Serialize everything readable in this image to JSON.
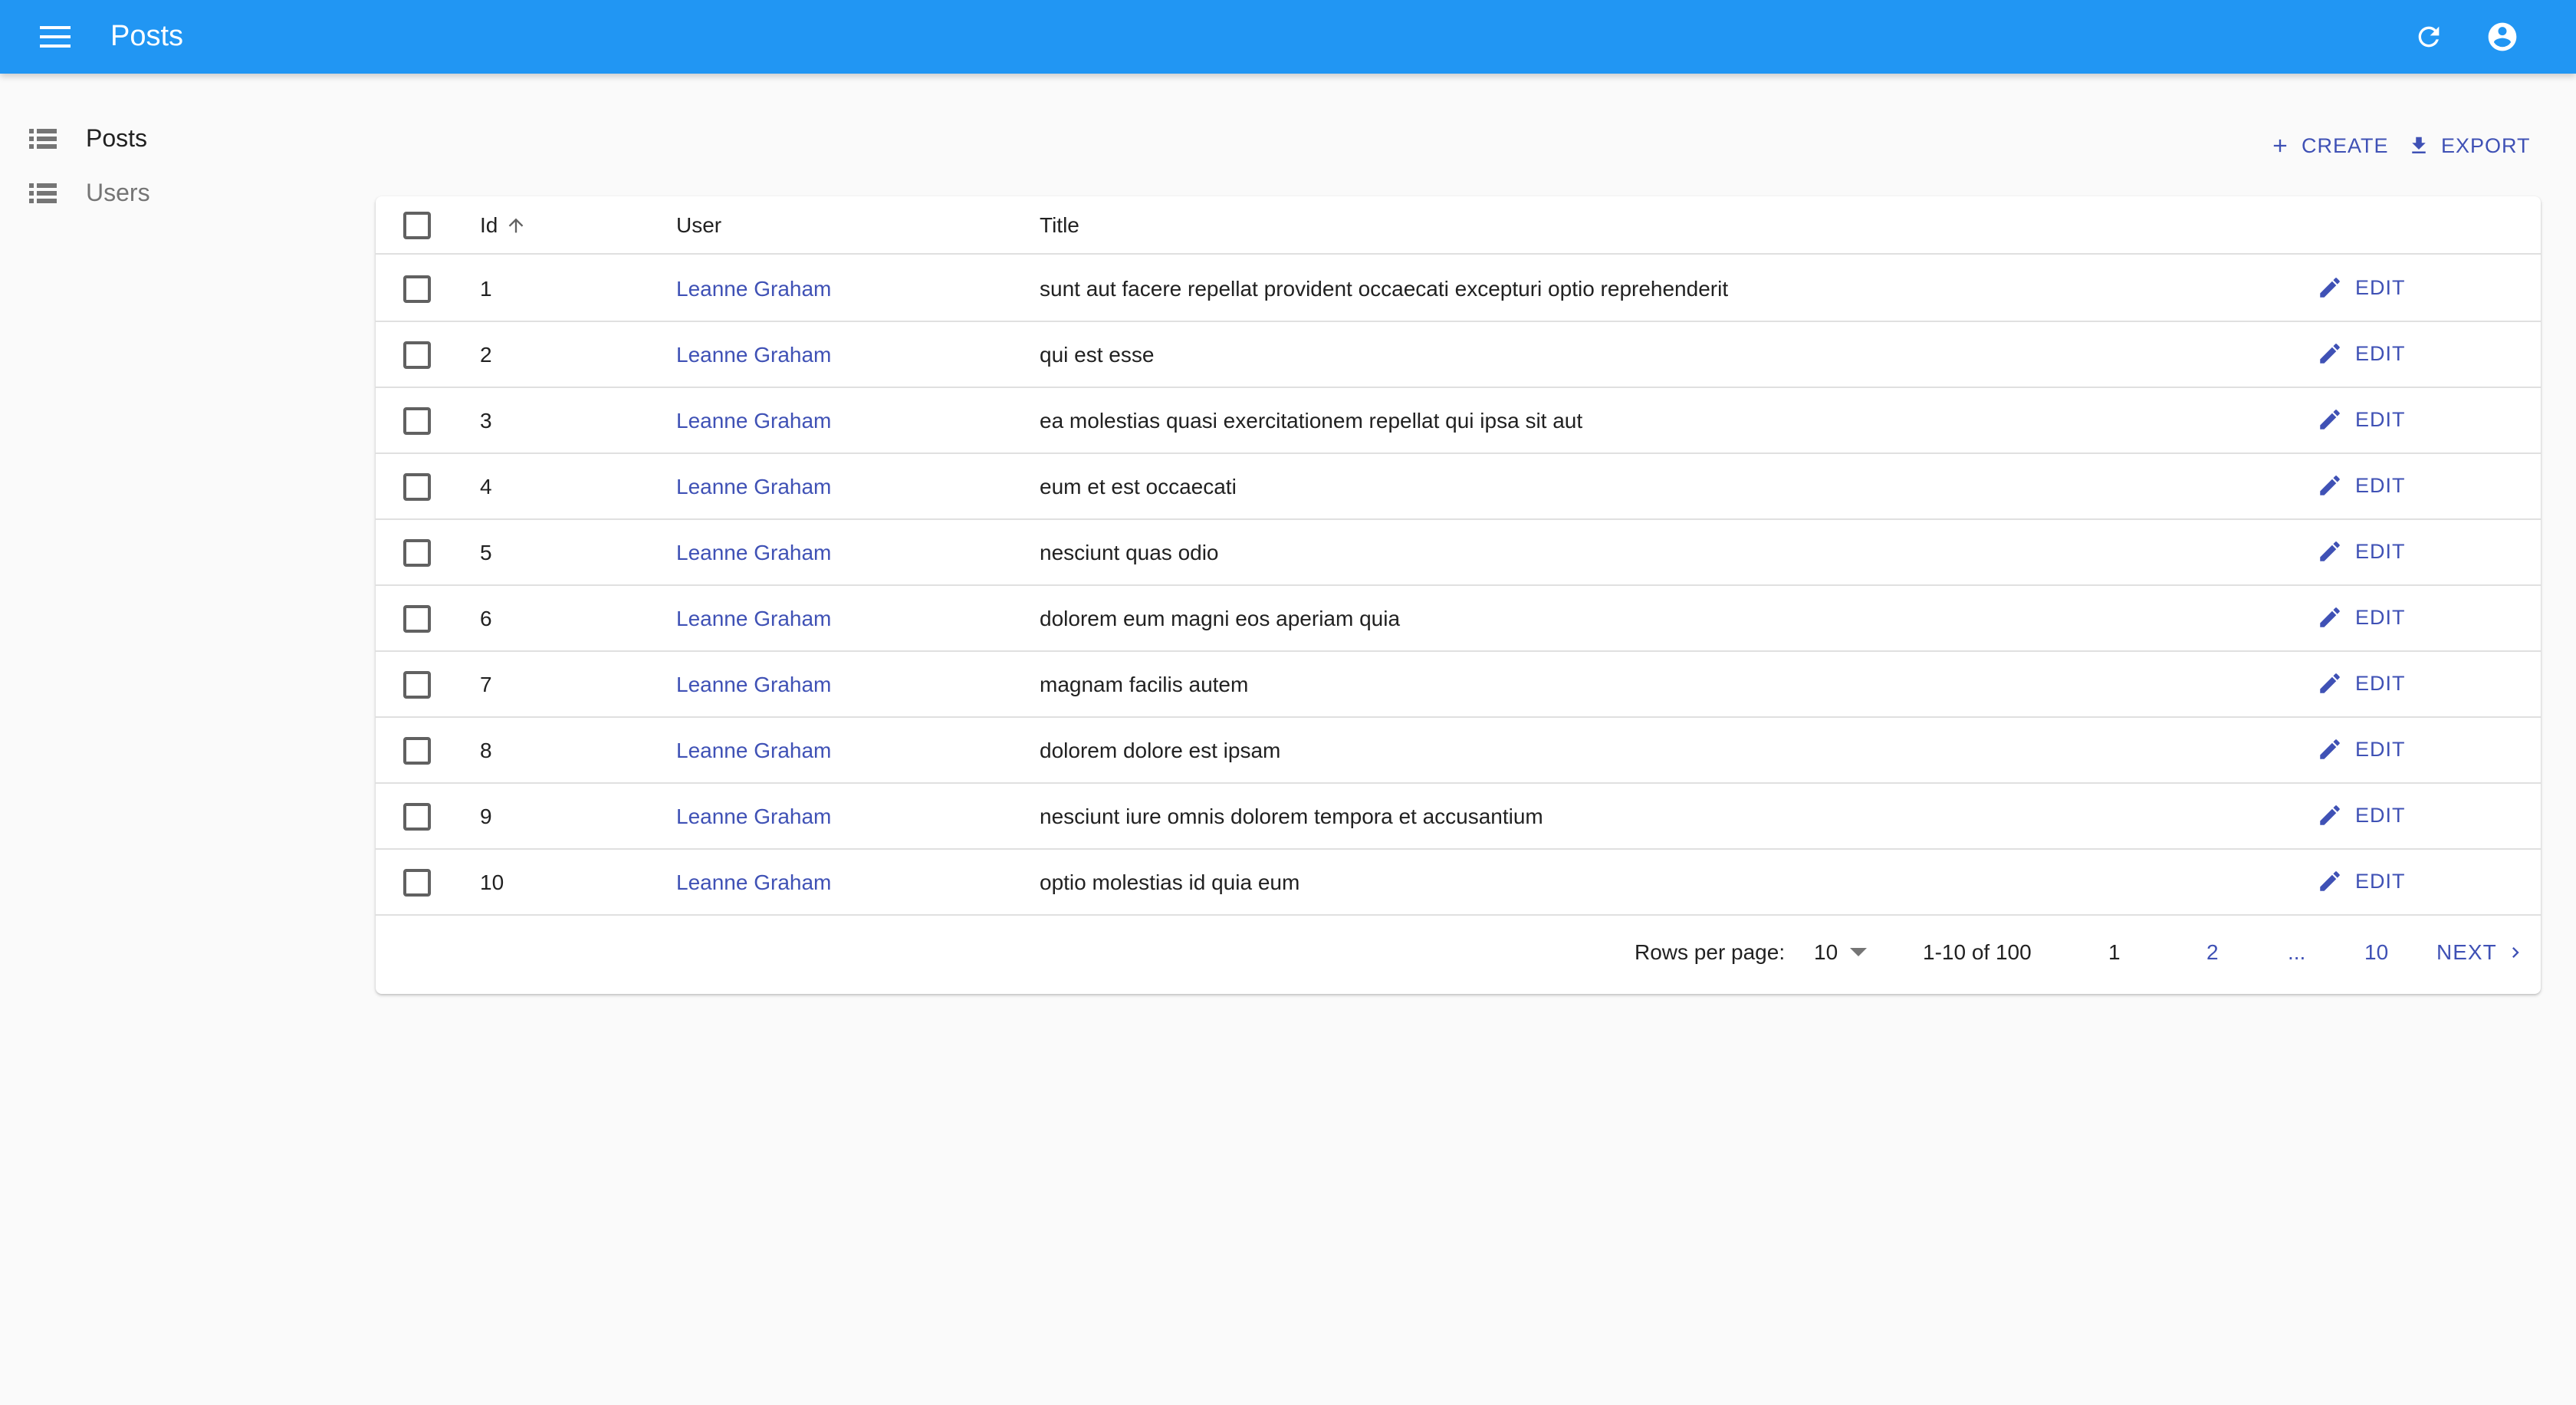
{
  "appbar": {
    "title": "Posts",
    "menu_icon": "menu-icon",
    "refresh_icon": "refresh-icon",
    "account_icon": "account-circle-icon",
    "color": "#2196f3"
  },
  "sidebar": {
    "items": [
      {
        "label": "Posts",
        "icon": "list-icon",
        "active": true
      },
      {
        "label": "Users",
        "icon": "list-icon",
        "active": false
      }
    ]
  },
  "actions": {
    "create_label": "CREATE",
    "export_label": "EXPORT"
  },
  "table": {
    "headers": {
      "id": "Id",
      "user": "User",
      "title": "Title"
    },
    "sort": {
      "column": "Id",
      "direction": "ascending"
    },
    "edit_label": "EDIT",
    "rows": [
      {
        "id": "1",
        "user": "Leanne Graham",
        "title": "sunt aut facere repellat provident occaecati excepturi optio reprehenderit"
      },
      {
        "id": "2",
        "user": "Leanne Graham",
        "title": "qui est esse"
      },
      {
        "id": "3",
        "user": "Leanne Graham",
        "title": "ea molestias quasi exercitationem repellat qui ipsa sit aut"
      },
      {
        "id": "4",
        "user": "Leanne Graham",
        "title": "eum et est occaecati"
      },
      {
        "id": "5",
        "user": "Leanne Graham",
        "title": "nesciunt quas odio"
      },
      {
        "id": "6",
        "user": "Leanne Graham",
        "title": "dolorem eum magni eos aperiam quia"
      },
      {
        "id": "7",
        "user": "Leanne Graham",
        "title": "magnam facilis autem"
      },
      {
        "id": "8",
        "user": "Leanne Graham",
        "title": "dolorem dolore est ipsam"
      },
      {
        "id": "9",
        "user": "Leanne Graham",
        "title": "nesciunt iure omnis dolorem tempora et accusantium"
      },
      {
        "id": "10",
        "user": "Leanne Graham",
        "title": "optio molestias id quia eum"
      }
    ]
  },
  "pagination": {
    "rows_per_page_label": "Rows per page:",
    "rows_per_page_value": "10",
    "range": "1-10 of 100",
    "pages": [
      "1",
      "2",
      "...",
      "10"
    ],
    "current_page": "1",
    "next_label": "NEXT"
  },
  "colors": {
    "accent": "#3f51b5",
    "divider": "#e0e0e0",
    "background": "#fafafa"
  }
}
